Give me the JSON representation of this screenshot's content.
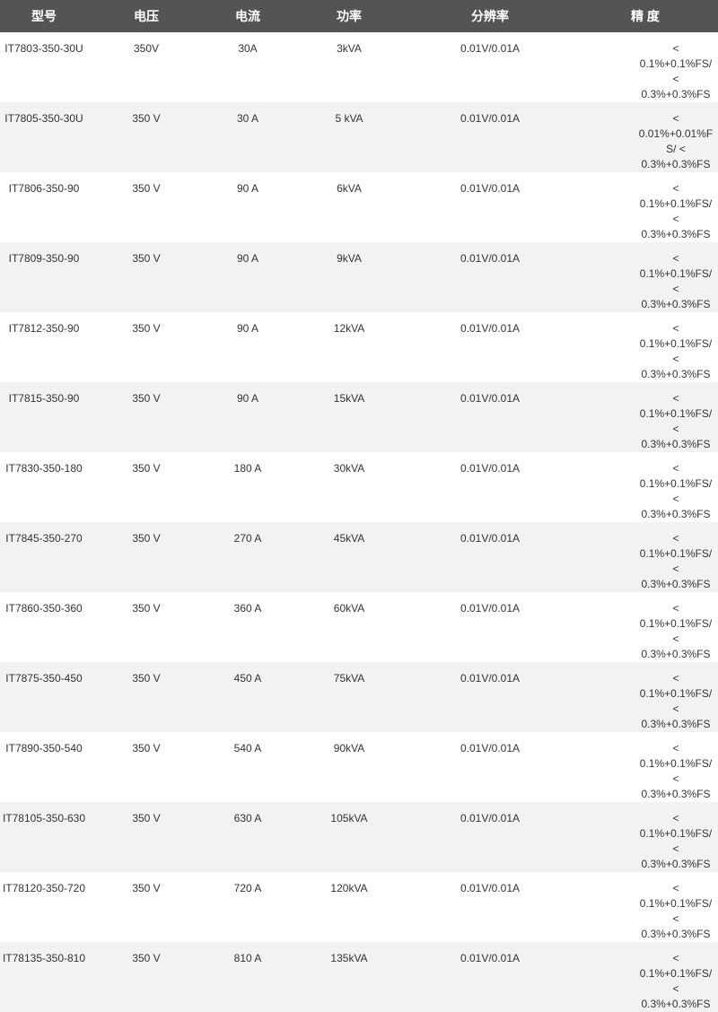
{
  "table": {
    "headers": [
      "型号",
      "电压",
      "电流",
      "功率",
      "分辨率",
      "精 度"
    ],
    "rows": [
      [
        "IT7803-350-30U",
        "350V",
        "30A",
        "3kVA",
        "0.01V/0.01A",
        "< 0.1%+0.1%FS/  < 0.3%+0.3%FS"
      ],
      [
        "IT7805-350-30U",
        "350 V",
        "30 A",
        "5 kVA",
        "0.01V/0.01A",
        "< 0.01%+0.01%FS/ < 0.3%+0.3%FS"
      ],
      [
        "IT7806-350-90",
        "350 V",
        "90 A",
        "6kVA",
        "0.01V/0.01A",
        "< 0.1%+0.1%FS/ < 0.3%+0.3%FS"
      ],
      [
        "IT7809-350-90",
        "350 V",
        "90 A",
        "9kVA",
        "0.01V/0.01A",
        "< 0.1%+0.1%FS/ < 0.3%+0.3%FS"
      ],
      [
        "IT7812-350-90",
        "350 V",
        "90 A",
        "12kVA",
        "0.01V/0.01A",
        "< 0.1%+0.1%FS/ < 0.3%+0.3%FS"
      ],
      [
        "IT7815-350-90",
        "350 V",
        "90 A",
        "15kVA",
        "0.01V/0.01A",
        "< 0.1%+0.1%FS/ < 0.3%+0.3%FS"
      ],
      [
        "IT7830-350-180",
        "350 V",
        "180 A",
        "30kVA",
        "0.01V/0.01A",
        "< 0.1%+0.1%FS/ < 0.3%+0.3%FS"
      ],
      [
        "IT7845-350-270",
        "350 V",
        "270 A",
        "45kVA",
        "0.01V/0.01A",
        "< 0.1%+0.1%FS/ < 0.3%+0.3%FS"
      ],
      [
        "IT7860-350-360",
        "350 V",
        "360 A",
        "60kVA",
        "0.01V/0.01A",
        "< 0.1%+0.1%FS/ < 0.3%+0.3%FS"
      ],
      [
        "IT7875-350-450",
        "350 V",
        "450 A",
        "75kVA",
        "0.01V/0.01A",
        "< 0.1%+0.1%FS/ < 0.3%+0.3%FS"
      ],
      [
        "IT7890-350-540",
        "350 V",
        "540 A",
        "90kVA",
        "0.01V/0.01A",
        "< 0.1%+0.1%FS/ < 0.3%+0.3%FS"
      ],
      [
        "IT78105-350-630",
        "350 V",
        "630 A",
        "105kVA",
        "0.01V/0.01A",
        "< 0.1%+0.1%FS/ < 0.3%+0.3%FS"
      ],
      [
        "IT78120-350-720",
        "350 V",
        "720 A",
        "120kVA",
        "0.01V/0.01A",
        "< 0.1%+0.1%FS/ < 0.3%+0.3%FS"
      ],
      [
        "IT78135-350-810",
        "350 V",
        "810 A",
        "135kVA",
        "0.01V/0.01A",
        "< 0.1%+0.1%FS/ < 0.3%+0.3%FS"
      ]
    ]
  },
  "colors": {
    "header_bg": "#545454",
    "header_text": "#ffffff",
    "row_alt_bg": "#f2f2f2",
    "body_text": "#333333"
  }
}
